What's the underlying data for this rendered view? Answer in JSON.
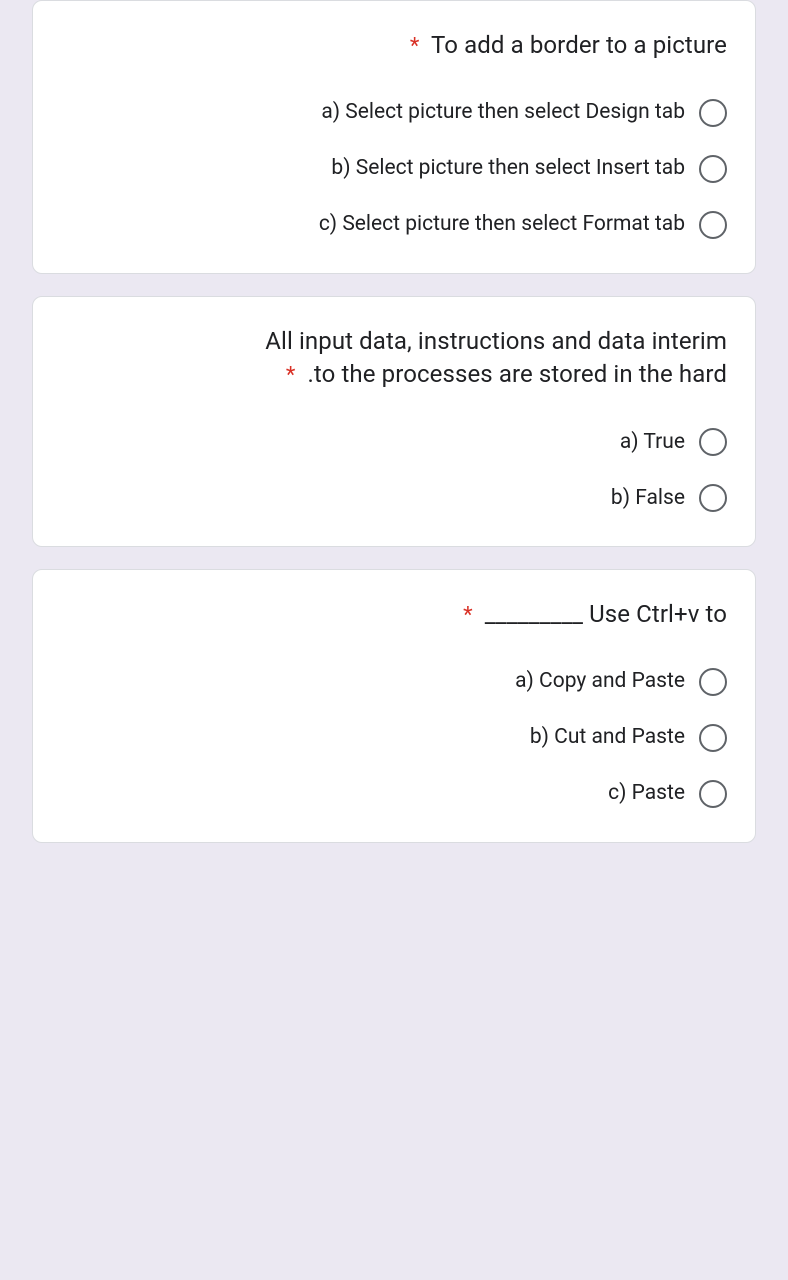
{
  "required": "*",
  "questions": [
    {
      "title": "To add a border to a picture",
      "options": [
        "a) Select picture then select Design tab",
        "b) Select picture then select Insert tab",
        "c) Select picture then select Format tab"
      ]
    },
    {
      "title": "All input data, instructions and data interim .to the processes are stored in the hard",
      "title_line1": "All input data, instructions and data interim",
      "title_line2": ".to the processes are stored in the hard",
      "options": [
        "a) True",
        "b) False"
      ]
    },
    {
      "title": "_________ Use Ctrl+v to",
      "options": [
        "a) Copy and Paste",
        "b) Cut and Paste",
        "c) Paste"
      ]
    }
  ]
}
